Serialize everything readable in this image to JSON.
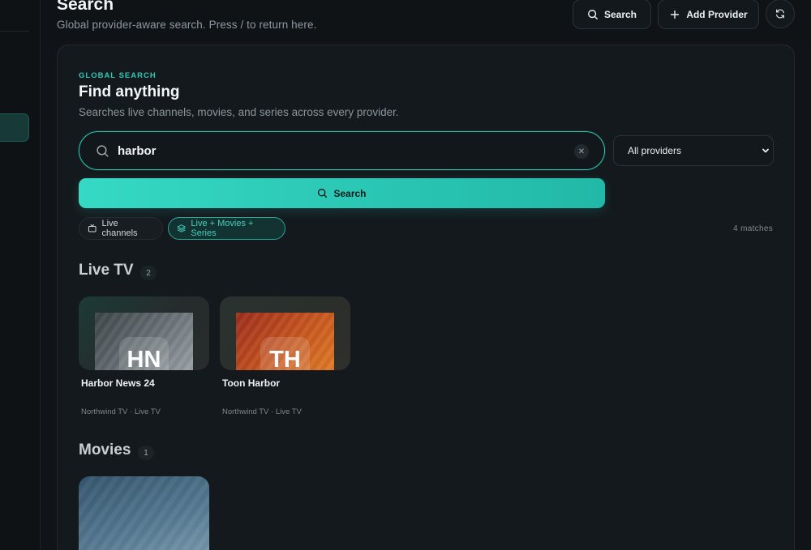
{
  "header": {
    "title": "Search",
    "subtitle": "Global provider-aware search. Press / to return here.",
    "search_label": "Search",
    "add_provider_label": "Add Provider"
  },
  "panel": {
    "eyebrow": "GLOBAL SEARCH",
    "title": "Find anything",
    "subtitle": "Searches live channels, movies, and series across every provider.",
    "search_value": "harbor",
    "provider_select": "All providers",
    "search_button": "Search",
    "chips": [
      "Live channels",
      "Live + Movies + Series"
    ],
    "active_chip": "Live + Movies + Series",
    "match_count": "4 matches"
  },
  "sections": {
    "live_tv": {
      "title": "Live TV",
      "count": "2",
      "items": [
        {
          "initials": "HN",
          "name": "Harbor News 24",
          "meta": "Northwind TV · Live TV",
          "colors": [
            "#3d4448",
            "#8b9499"
          ]
        },
        {
          "initials": "TH",
          "name": "Toon Harbor",
          "meta": "Northwind TV · Live TV",
          "colors": [
            "#9c2d1c",
            "#e07a26"
          ]
        }
      ]
    },
    "movies": {
      "title": "Movies",
      "count": "1"
    }
  },
  "colors": {
    "accent": "#2fc9b6",
    "background": "#101418",
    "panel": "#14191d"
  },
  "icons": {
    "header_search": "search-icon",
    "add": "plus-icon",
    "refresh": "refresh-icon",
    "input_search": "search-icon",
    "clear": "close-icon",
    "live_chip": "tv-icon",
    "all_chip": "layers-icon"
  }
}
